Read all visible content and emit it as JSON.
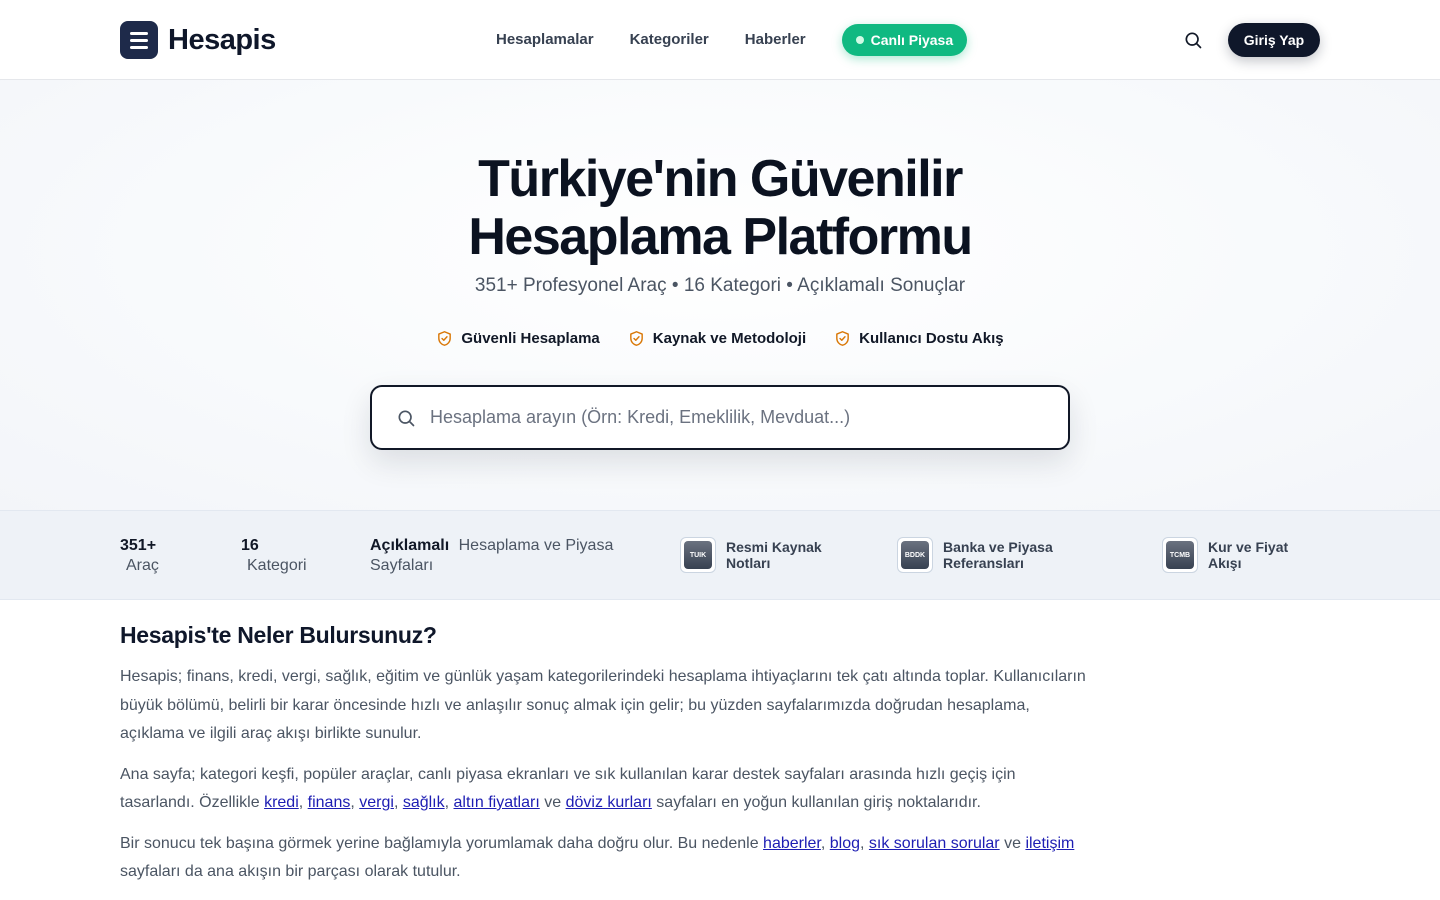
{
  "header": {
    "logo_text": "Hesapis",
    "nav": [
      "Hesaplamalar",
      "Kategoriler",
      "Haberler"
    ],
    "live_label": "Canlı Piyasa",
    "login_label": "Giriş Yap"
  },
  "hero": {
    "title_line1": "Türkiye'nin Güvenilir",
    "title_line2": "Hesaplama Platformu",
    "subtitle": "351+ Profesyonel Araç • 16 Kategori • Açıklamalı Sonuçlar",
    "badges": [
      "Güvenli Hesaplama",
      "Kaynak ve Metodoloji",
      "Kullanıcı Dostu Akış"
    ],
    "search_placeholder": "Hesaplama arayın (Örn: Kredi, Emeklilik, Mevduat...)"
  },
  "stats": {
    "tools_num": "351+",
    "tools_label": "Araç",
    "cat_num": "16",
    "cat_label": "Kategori",
    "desc_bold": "Açıklamalı",
    "desc_rest": "Hesaplama ve Piyasa",
    "desc_line2": "Sayfaları",
    "sources": [
      {
        "abbr": "TUIK",
        "line1": "Resmi Kaynak",
        "line2": "Notları"
      },
      {
        "abbr": "BDDK",
        "line1": "Banka ve Piyasa",
        "line2": "Referansları"
      },
      {
        "abbr": "TCMB",
        "line1": "Kur ve Fiyat",
        "line2": "Akışı"
      }
    ]
  },
  "content": {
    "heading": "Hesapis'te Neler Bulursunuz?",
    "p1": "Hesapis; finans, kredi, vergi, sağlık, eğitim ve günlük yaşam kategorilerindeki hesaplama ihtiyaçlarını tek çatı altında toplar. Kullanıcıların büyük bölümü, belirli bir karar öncesinde hızlı ve anlaşılır sonuç almak için gelir; bu yüzden sayfalarımızda doğrudan hesaplama, açıklama ve ilgili araç akışı birlikte sunulur.",
    "p2_pre": "Ana sayfa; kategori keşfi, popüler araçlar, canlı piyasa ekranları ve sık kullanılan karar destek sayfaları arasında hızlı geçiş için tasarlandı. Özellikle",
    "p2_links": [
      "kredi",
      "finans",
      "vergi",
      "sağlık",
      "altın fiyatları",
      "döviz kurları"
    ],
    "p2_and": "ve",
    "p2_post": "sayfaları en yoğun kullanılan giriş noktalarıdır.",
    "p3_pre": "Bir sonucu tek başına görmek yerine bağlamıyla yorumlamak daha doğru olur. Bu nedenle",
    "p3_links": [
      "haberler",
      "blog",
      "sık sorulan sorular",
      "iletişim"
    ],
    "p3_and": "ve",
    "p3_post": "sayfaları da ana akışın bir parçası olarak tutulur."
  }
}
